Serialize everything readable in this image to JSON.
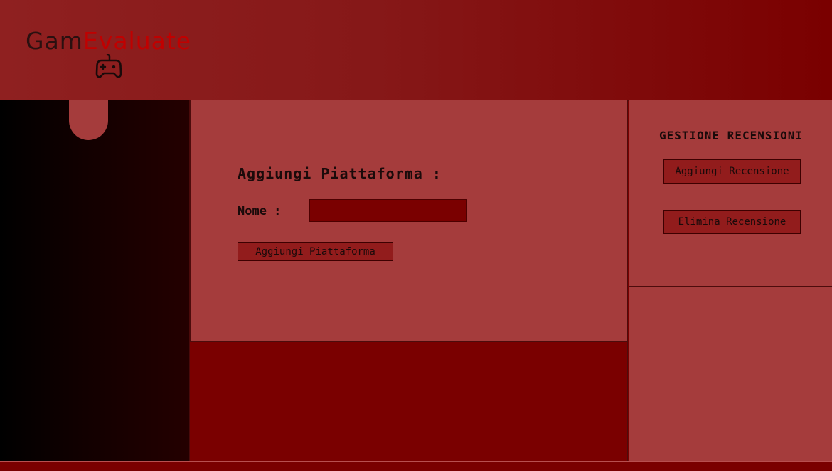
{
  "brand": {
    "name_part1": "Gam",
    "name_part2": "Evaluate",
    "icon": "gamepad-icon",
    "color_part1": "#2a1010",
    "color_part2": "#c00000"
  },
  "main": {
    "title": "Aggiungi Piattaforma :",
    "name_label": "Nome :",
    "name_value": "",
    "submit_label": "Aggiungi Piattaforma"
  },
  "reviews": {
    "title": "GESTIONE RECENSIONI",
    "add_label": "Aggiungi Recensione",
    "delete_label": "Elimina Recensione"
  },
  "colors": {
    "accent_dark": "#7a0000",
    "panel": "#a53c3c",
    "button": "#921c1c"
  }
}
